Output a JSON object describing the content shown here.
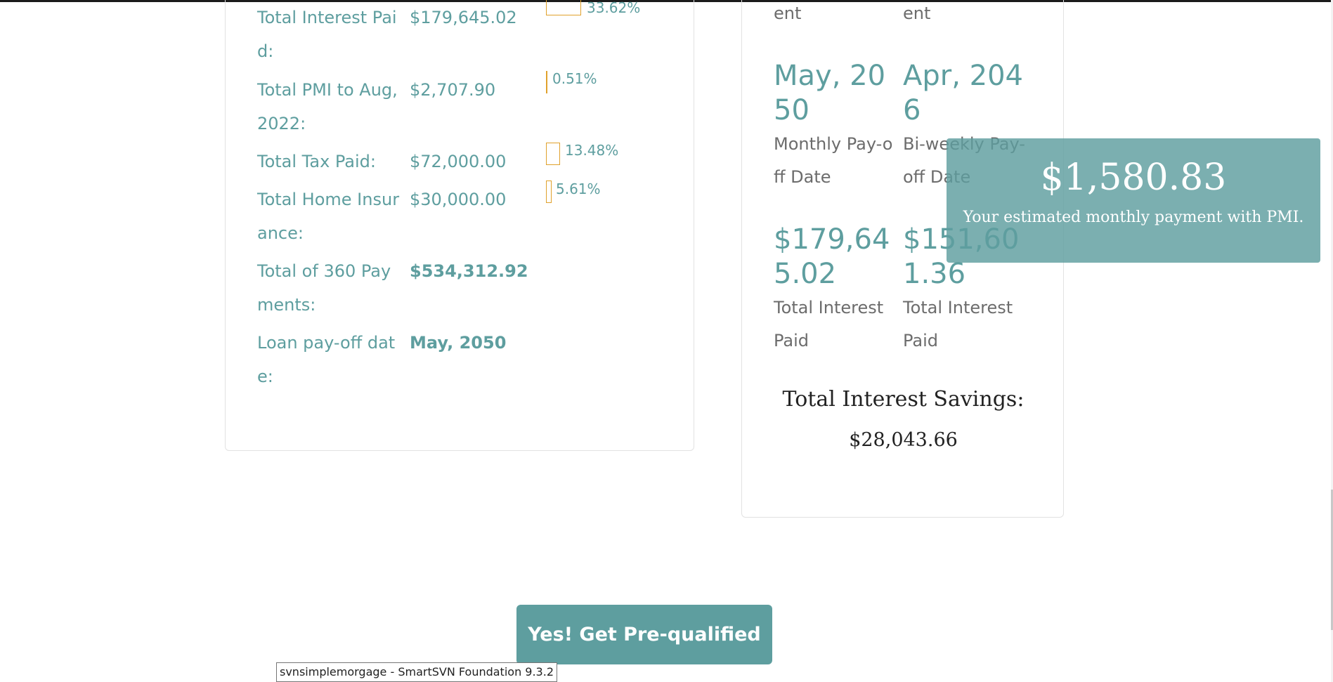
{
  "left_summary": {
    "rows": [
      {
        "label": "Total Interest Paid:",
        "value": "$179,645.02",
        "percent": "33.62%",
        "share": 0.3362
      },
      {
        "label": "Total PMI to Aug, 2022:",
        "value": "$2,707.90",
        "percent": "0.51%",
        "share": 0.0051
      },
      {
        "label": "Total Tax Paid:",
        "value": "$72,000.00",
        "percent": "13.48%",
        "share": 0.1348
      },
      {
        "label": "Total Home Insurance:",
        "value": "$30,000.00",
        "percent": "5.61%",
        "share": 0.0561
      },
      {
        "label": "Total of 360 Payments:",
        "value": "$534,312.92"
      },
      {
        "label": "Loan pay-off date:",
        "value": "May, 2050"
      }
    ]
  },
  "comparison": {
    "top_labels": [
      "ent",
      "ent"
    ],
    "payoff": {
      "monthly_date": "May, 2050",
      "monthly_label": "Monthly Pay-off Date",
      "biweekly_date": "Apr, 2046",
      "biweekly_label": "Bi-weekly Pay-off Date"
    },
    "interest": {
      "monthly_value": "$179,645.02",
      "monthly_label": "Total Interest Paid",
      "biweekly_value": "$151,601.36",
      "biweekly_label": "Total Interest Paid"
    },
    "savings_title": "Total Interest Savings:",
    "savings_value": "$28,043.66"
  },
  "bubble": {
    "amount": "$1,580.83",
    "caption": "Your estimated monthly payment with PMI."
  },
  "cta": {
    "label": "Yes! Get Pre-qualified"
  },
  "tooltip": {
    "text": "svnsimplemorgage - SmartSVN Foundation 9.3.2"
  },
  "colors": {
    "accent": "#5e9e9f",
    "bar_border": "#e0a12c",
    "bubble": "#5e9e9f"
  }
}
